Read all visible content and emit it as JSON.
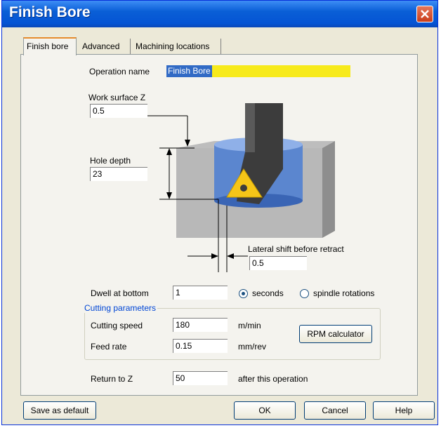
{
  "window": {
    "title": "Finish Bore"
  },
  "tabs": [
    {
      "label": "Finish bore",
      "active": true
    },
    {
      "label": "Advanced",
      "active": false
    },
    {
      "label": "Machining locations",
      "active": false
    }
  ],
  "form": {
    "operation_name_label": "Operation name",
    "operation_name_value": "Finish Bore",
    "work_surface_label": "Work surface Z",
    "work_surface_value": "0.5",
    "hole_depth_label": "Hole depth",
    "hole_depth_value": "23",
    "lateral_shift_label": "Lateral shift before retract",
    "lateral_shift_value": "0.5",
    "dwell_label": "Dwell at bottom",
    "dwell_value": "1",
    "dwell_options": [
      {
        "label": "seconds",
        "selected": true
      },
      {
        "label": "spindle rotations",
        "selected": false
      }
    ],
    "cutting_group_label": "Cutting parameters",
    "cutting_speed_label": "Cutting speed",
    "cutting_speed_value": "180",
    "cutting_speed_unit": "m/min",
    "feed_rate_label": "Feed rate",
    "feed_rate_value": "0.15",
    "feed_rate_unit": "mm/rev",
    "rpm_button": "RPM calculator",
    "return_label": "Return to Z",
    "return_value": "50",
    "return_suffix": "after this operation"
  },
  "buttons": {
    "save_default": "Save as default",
    "ok": "OK",
    "cancel": "Cancel",
    "help": "Help"
  },
  "colors": {
    "titlebar": "#0554d4",
    "highlight": "#f7ea1b",
    "selection": "#316ac5",
    "insert": "#f5c518"
  }
}
